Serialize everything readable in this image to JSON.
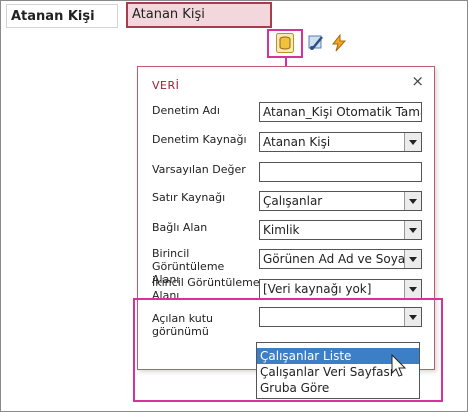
{
  "field": {
    "label": "Atanan Kişi",
    "value": "Atanan Kişi"
  },
  "toolbar": {
    "icons": [
      "data-icon",
      "format-icon",
      "action-icon"
    ]
  },
  "popup": {
    "title": "VERİ",
    "close_label": "×",
    "rows": [
      {
        "label": "Denetim Adı",
        "value": "Atanan_Kişi Otomatik Tama"
      },
      {
        "label": "Denetim Kaynağı",
        "value": "Atanan Kişi"
      },
      {
        "label": "Varsayılan Değer",
        "value": ""
      },
      {
        "label": "Satır Kaynağı",
        "value": "Çalışanlar"
      },
      {
        "label": "Bağlı Alan",
        "value": "Kimlik"
      },
      {
        "label": "Birincil Görüntüleme Alanı",
        "value": "Görünen Ad Ad ve Soya"
      },
      {
        "label": "İkincil Görüntüleme Alanı",
        "value": "[Veri kaynağı yok]"
      },
      {
        "label": "Açılan kutu görünümü",
        "value": ""
      }
    ],
    "dropdown_options": [
      "Çalışanlar Liste",
      "Çalışanlar Veri Sayfası",
      "Gruba Göre"
    ],
    "selected_option": "Çalışanlar Liste"
  },
  "colors": {
    "accent": "#a63c4e",
    "highlight": "#d6339a",
    "selection": "#3d7fc6"
  }
}
